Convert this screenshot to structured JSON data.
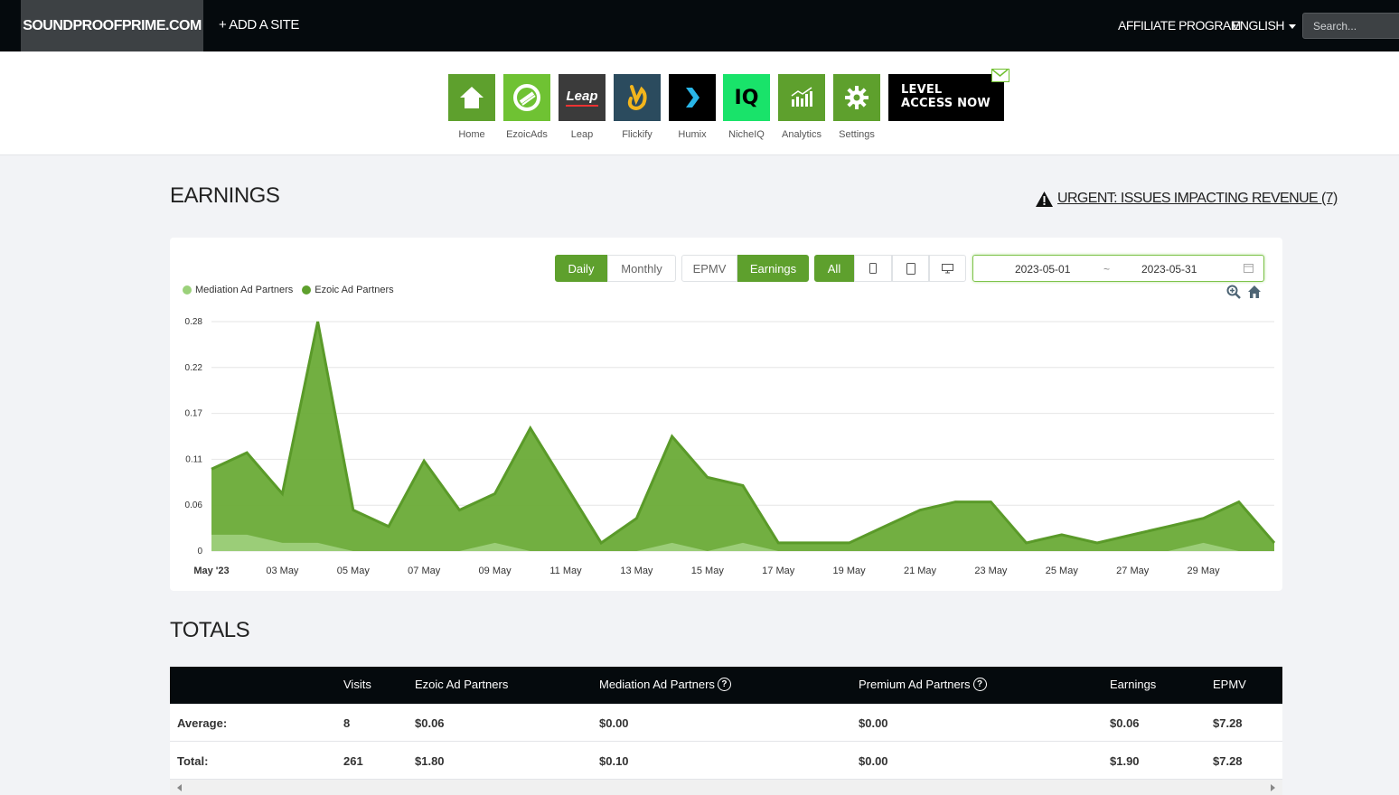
{
  "nav": {
    "brand": "SOUNDPROOFPRIME.COM",
    "add_site": "+ ADD A SITE",
    "affiliate": "AFFILIATE PROGRAM",
    "language": "ENGLISH",
    "search_placeholder": "Search..."
  },
  "apps": [
    {
      "label": "Home",
      "icon": "house-icon",
      "color": "#5ea02d"
    },
    {
      "label": "EzoicAds",
      "icon": "ezoic-ads-icon",
      "color": "#6fc233"
    },
    {
      "label": "Leap",
      "icon": "leap-icon",
      "color": "#3b3b3b"
    },
    {
      "label": "Flickify",
      "icon": "flickify-icon",
      "color": "#2b4b5e"
    },
    {
      "label": "Humix",
      "icon": "humix-icon",
      "color": "#000000"
    },
    {
      "label": "NicheIQ",
      "icon": "nicheiq-icon",
      "color": "#19e36a"
    },
    {
      "label": "Analytics",
      "icon": "analytics-icon",
      "color": "#5ea02d"
    },
    {
      "label": "Settings",
      "icon": "gear-icon",
      "color": "#5ea02d"
    }
  ],
  "level_access": {
    "line1": "LEVEL",
    "line2": "ACCESS NOW"
  },
  "leap_logo": "Leap",
  "nicheiq_logo": "IQ",
  "earnings_title": "EARNINGS",
  "urgent_link": "URGENT: ISSUES IMPACTING REVENUE (7)",
  "controls": {
    "daily": "Daily",
    "monthly": "Monthly",
    "epmv": "EPMV",
    "earnings": "Earnings",
    "all": "All",
    "date_start": "2023-05-01",
    "date_sep": "~",
    "date_end": "2023-05-31"
  },
  "colors": {
    "accent": "#5ea02d",
    "mediation": "#9bd17a",
    "ezoic": "#5ea02d"
  },
  "chart_data": {
    "type": "area",
    "stacked": true,
    "x": [
      "2023-05-01",
      "2023-05-02",
      "2023-05-03",
      "2023-05-04",
      "2023-05-05",
      "2023-05-06",
      "2023-05-07",
      "2023-05-08",
      "2023-05-09",
      "2023-05-10",
      "2023-05-11",
      "2023-05-12",
      "2023-05-13",
      "2023-05-14",
      "2023-05-15",
      "2023-05-16",
      "2023-05-17",
      "2023-05-18",
      "2023-05-19",
      "2023-05-20",
      "2023-05-21",
      "2023-05-22",
      "2023-05-23",
      "2023-05-24",
      "2023-05-25",
      "2023-05-26",
      "2023-05-27",
      "2023-05-28",
      "2023-05-29",
      "2023-05-30",
      "2023-05-31"
    ],
    "series": [
      {
        "name": "Mediation Ad Partners",
        "values": [
          0.02,
          0.02,
          0.01,
          0.01,
          0,
          0,
          0,
          0,
          0.01,
          0,
          0,
          0,
          0,
          0.01,
          0,
          0.01,
          0,
          0,
          0,
          0,
          0,
          0,
          0,
          0,
          0,
          0,
          0,
          0,
          0.01,
          0,
          0
        ]
      },
      {
        "name": "Ezoic Ad Partners",
        "values": [
          0.08,
          0.1,
          0.06,
          0.27,
          0.05,
          0.03,
          0.11,
          0.05,
          0.06,
          0.15,
          0.08,
          0.01,
          0.04,
          0.13,
          0.09,
          0.07,
          0.01,
          0.01,
          0.01,
          0.03,
          0.05,
          0.06,
          0.06,
          0.01,
          0.02,
          0.01,
          0.02,
          0.03,
          0.03,
          0.06,
          0.01
        ]
      }
    ],
    "yticks": [
      "0",
      "0.06",
      "0.11",
      "0.17",
      "0.22",
      "0.28"
    ],
    "ytick_values": [
      0,
      0.056,
      0.112,
      0.168,
      0.224,
      0.28
    ],
    "ylim": [
      0,
      0.28
    ],
    "xticks": [
      "May '23",
      "03 May",
      "05 May",
      "07 May",
      "09 May",
      "11 May",
      "13 May",
      "15 May",
      "17 May",
      "19 May",
      "21 May",
      "23 May",
      "25 May",
      "27 May",
      "29 May"
    ],
    "xtick_index": [
      0,
      2,
      4,
      6,
      8,
      10,
      12,
      14,
      16,
      18,
      20,
      22,
      24,
      26,
      28
    ],
    "grid": true,
    "legend": "top-left"
  },
  "totals_title": "TOTALS",
  "table": {
    "headers": [
      "Visits",
      "Ezoic Ad Partners",
      "Mediation Ad Partners",
      "Premium Ad Partners",
      "Earnings",
      "EPMV"
    ],
    "rows": [
      {
        "label": "Average:",
        "cells": [
          "8",
          "$0.06",
          "$0.00",
          "$0.00",
          "$0.06",
          "$7.28"
        ]
      },
      {
        "label": "Total:",
        "cells": [
          "261",
          "$1.80",
          "$0.10",
          "$0.00",
          "$1.90",
          "$7.28"
        ]
      }
    ]
  }
}
